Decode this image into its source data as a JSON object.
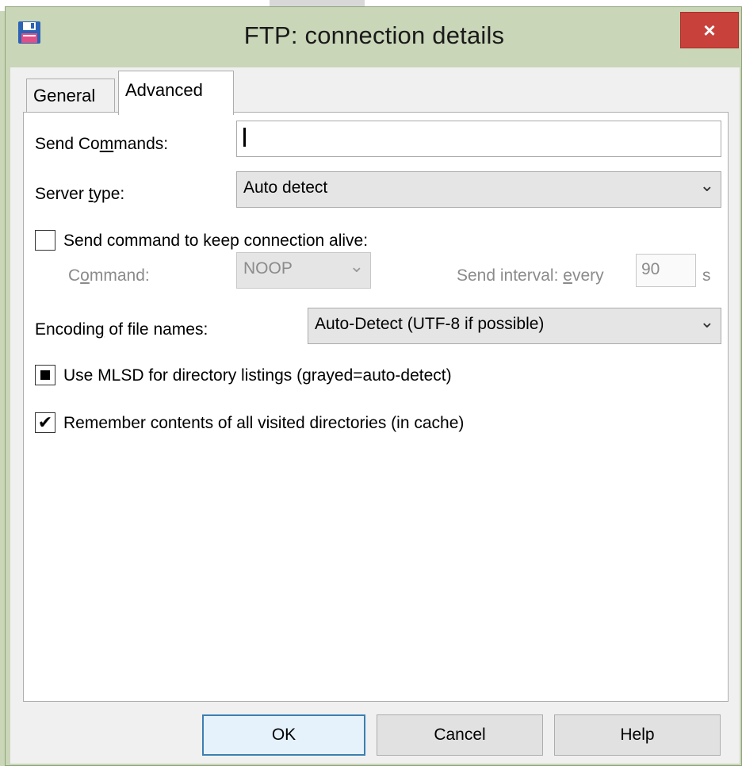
{
  "window": {
    "title": "FTP: connection details",
    "close_glyph": "×"
  },
  "tabs": [
    {
      "label": "General",
      "active": false
    },
    {
      "label": "Advanced",
      "active": true
    }
  ],
  "send_commands": {
    "label_pre": "Send Co",
    "label_u": "m",
    "label_post": "mands:",
    "value": ""
  },
  "server_type": {
    "label_pre": "Server ",
    "label_u": "t",
    "label_post": "ype:",
    "value": "Auto detect"
  },
  "keep_alive": {
    "label": "Send command to keep connection alive:",
    "checked": false,
    "command_label_pre": "C",
    "command_label_u": "o",
    "command_label_post": "mmand:",
    "command_value": "NOOP",
    "interval_label_pre": "Send interval: ",
    "interval_label_u": "e",
    "interval_label_post": "very",
    "interval_value": "90",
    "interval_unit": "s"
  },
  "encoding": {
    "label_pre": "Encodin",
    "label_u": "g",
    "label_post": " of file names:",
    "value": "Auto-Detect (UTF-8 if possible)"
  },
  "mlsd": {
    "label": "Use MLSD for directory listings (grayed=auto-detect)",
    "state": "indeterminate"
  },
  "cache": {
    "label": "Remember contents of all visited directories (in cache)",
    "checked": true
  },
  "buttons": {
    "ok": "OK",
    "cancel": "Cancel",
    "help": "Help"
  },
  "icons": {
    "app": "floppy-disk-icon",
    "dropdown": "chevron-down-icon",
    "checkmark": "✔"
  },
  "colors": {
    "frame": "#c9d6b8",
    "close": "#c8413b",
    "default_button_border": "#3c7fb1"
  }
}
